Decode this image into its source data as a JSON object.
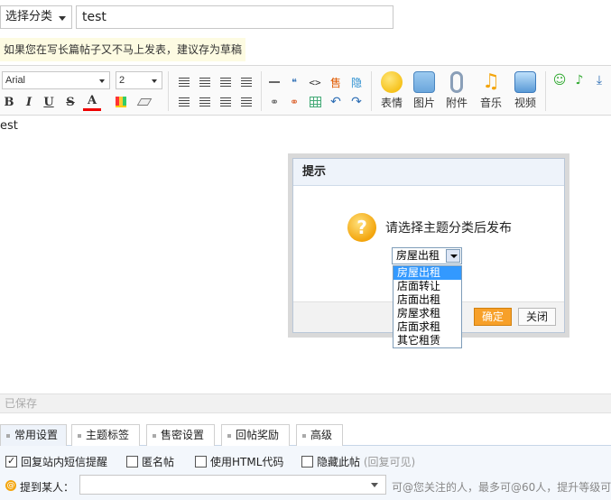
{
  "top": {
    "category_select": "选择分类",
    "title_value": "test"
  },
  "tip": "如果您在写长篇帖子又不马上发表，建议存为草稿",
  "toolbar": {
    "font_family": "Arial",
    "font_size": "2",
    "bold": "B",
    "italic": "I",
    "underline": "U",
    "strike": "S",
    "font_color": "A",
    "big_buttons": [
      {
        "label": "表情",
        "icon": "smiley-icon",
        "color": "#f6c21c"
      },
      {
        "label": "图片",
        "icon": "picture-icon",
        "color": "#6aa6dc"
      },
      {
        "label": "附件",
        "icon": "paperclip-icon",
        "color": "#8a9fb8"
      },
      {
        "label": "音乐",
        "icon": "music-note-icon",
        "color": "#f3a50d"
      },
      {
        "label": "视频",
        "icon": "video-icon",
        "color": "#5a9ad6"
      }
    ]
  },
  "editor": {
    "body_text": "est"
  },
  "dialog": {
    "title": "提示",
    "message": "请选择主题分类后发布",
    "select_value": "房屋出租",
    "options": [
      "房屋出租",
      "店面转让",
      "店面出租",
      "房屋求租",
      "店面求租",
      "其它租赁"
    ],
    "ok_label": "确定",
    "close_label": "关闭"
  },
  "saved_status": "已保存",
  "tabs": [
    {
      "label": "常用设置",
      "active": true
    },
    {
      "label": "主题标签",
      "active": false
    },
    {
      "label": "售密设置",
      "active": false
    },
    {
      "label": "回帖奖励",
      "active": false
    },
    {
      "label": "高级",
      "active": false
    }
  ],
  "options": {
    "reply_notify": "回复站内短信提醒",
    "anonymous": "匿名帖",
    "use_html": "使用HTML代码",
    "hide_post": "隐藏此帖",
    "hide_post_hint": "(回复可见)",
    "mention_label": "提到某人：",
    "mention_hint": "可@您关注的人，最多可@60人，提升等级可"
  },
  "colors": {
    "accent_orange": "#f7a029",
    "dropdown_highlight": "#3399ff",
    "dialog_header": "#eef3fa"
  }
}
